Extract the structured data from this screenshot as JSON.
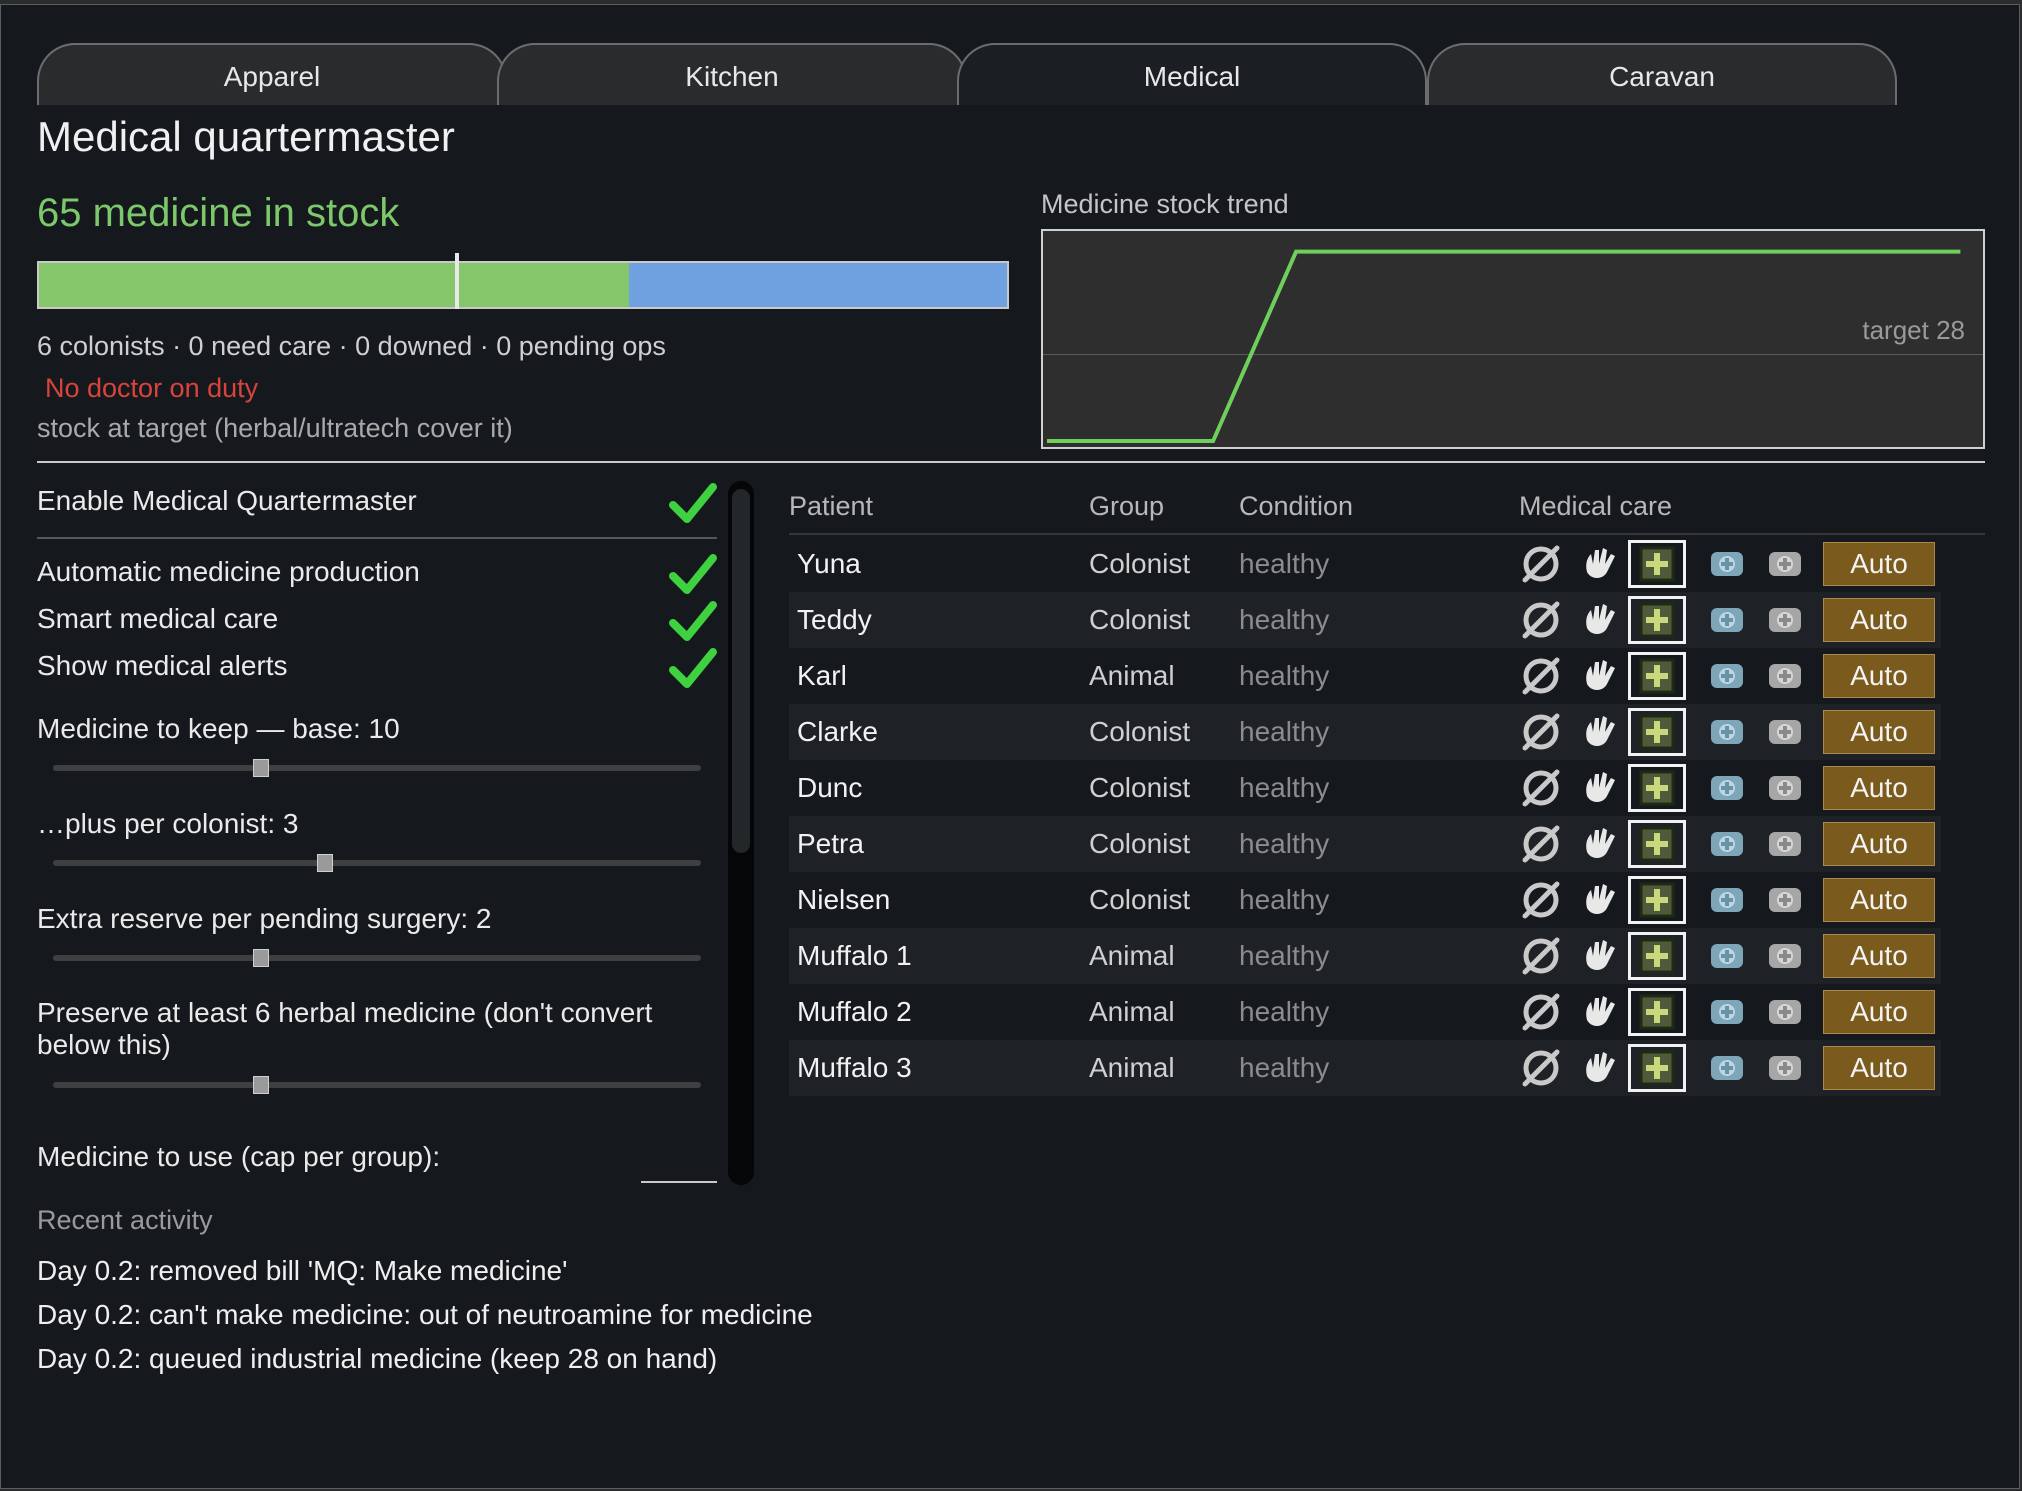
{
  "tabs": [
    {
      "label": "Apparel"
    },
    {
      "label": "Kitchen"
    },
    {
      "label": "Medical"
    },
    {
      "label": "Caravan"
    }
  ],
  "active_tab": "Medical",
  "header": {
    "title": "Medical quartermaster",
    "stock_text": "65 medicine in stock",
    "stock_bar": {
      "filled_fraction": 0.61,
      "target_marker_fraction": 0.43
    },
    "summary": "6 colonists · 0 need care · 0 downed · 0 pending ops",
    "alert": "No doctor on duty",
    "status": "stock at target (herbal/ultratech cover it)"
  },
  "trend": {
    "title": "Medicine stock trend",
    "target_label": "target 28"
  },
  "chart_data": {
    "type": "line",
    "title": "Medicine stock trend",
    "series": [
      {
        "values": [
          0,
          0,
          0,
          65,
          65,
          65,
          65,
          65,
          65,
          65,
          65,
          65
        ]
      }
    ],
    "ylim": [
      0,
      70
    ],
    "target": 28
  },
  "settings": {
    "enable_label": "Enable Medical Quartermaster",
    "enable_checked": true,
    "toggles": [
      {
        "label": "Automatic medicine production",
        "checked": true
      },
      {
        "label": "Smart medical care",
        "checked": true
      },
      {
        "label": "Show medical alerts",
        "checked": true
      }
    ],
    "sliders": [
      {
        "label": "Medicine to keep — base: 10",
        "value_fraction": 0.2
      },
      {
        "label": "…plus per colonist: 3",
        "value_fraction": 0.3
      },
      {
        "label": "Extra reserve per pending surgery: 2",
        "value_fraction": 0.2
      },
      {
        "label": "Preserve at least 6 herbal medicine (don't convert below this)",
        "value_fraction": 0.2
      }
    ],
    "use_cap_label": "Medicine to use (cap per group):"
  },
  "patients_table": {
    "headers": {
      "patient": "Patient",
      "group": "Group",
      "condition": "Condition",
      "care": "Medical care"
    },
    "rows": [
      {
        "name": "Yuna",
        "group": "Colonist",
        "condition": "healthy",
        "auto": "Auto"
      },
      {
        "name": "Teddy",
        "group": "Colonist",
        "condition": "healthy",
        "auto": "Auto"
      },
      {
        "name": "Karl",
        "group": "Animal",
        "condition": "healthy",
        "auto": "Auto"
      },
      {
        "name": "Clarke",
        "group": "Colonist",
        "condition": "healthy",
        "auto": "Auto"
      },
      {
        "name": "Dunc",
        "group": "Colonist",
        "condition": "healthy",
        "auto": "Auto"
      },
      {
        "name": "Petra",
        "group": "Colonist",
        "condition": "healthy",
        "auto": "Auto"
      },
      {
        "name": "Nielsen",
        "group": "Colonist",
        "condition": "healthy",
        "auto": "Auto"
      },
      {
        "name": "Muffalo 1",
        "group": "Animal",
        "condition": "healthy",
        "auto": "Auto"
      },
      {
        "name": "Muffalo 2",
        "group": "Animal",
        "condition": "healthy",
        "auto": "Auto"
      },
      {
        "name": "Muffalo 3",
        "group": "Animal",
        "condition": "healthy",
        "auto": "Auto"
      }
    ],
    "care_icons": [
      "no-care-icon",
      "no-meds-icon",
      "herbal-medicine-icon",
      "industrial-medicine-icon",
      "glitterworld-medicine-icon"
    ],
    "selected_care": "herbal-medicine-icon"
  },
  "recent": {
    "title": "Recent activity",
    "items": [
      "Day 0.2: removed bill 'MQ: Make medicine'",
      "Day 0.2: can't make medicine: out of neutroamine for medicine",
      "Day 0.2: queued industrial medicine (keep 28 on hand)"
    ]
  },
  "colors": {
    "stock_green": "#7cc86a",
    "bar_blue": "#6fa1e0",
    "alert_red": "#d8433b",
    "auto_button": "#7a5a1d",
    "check_green": "#3fd13f"
  }
}
